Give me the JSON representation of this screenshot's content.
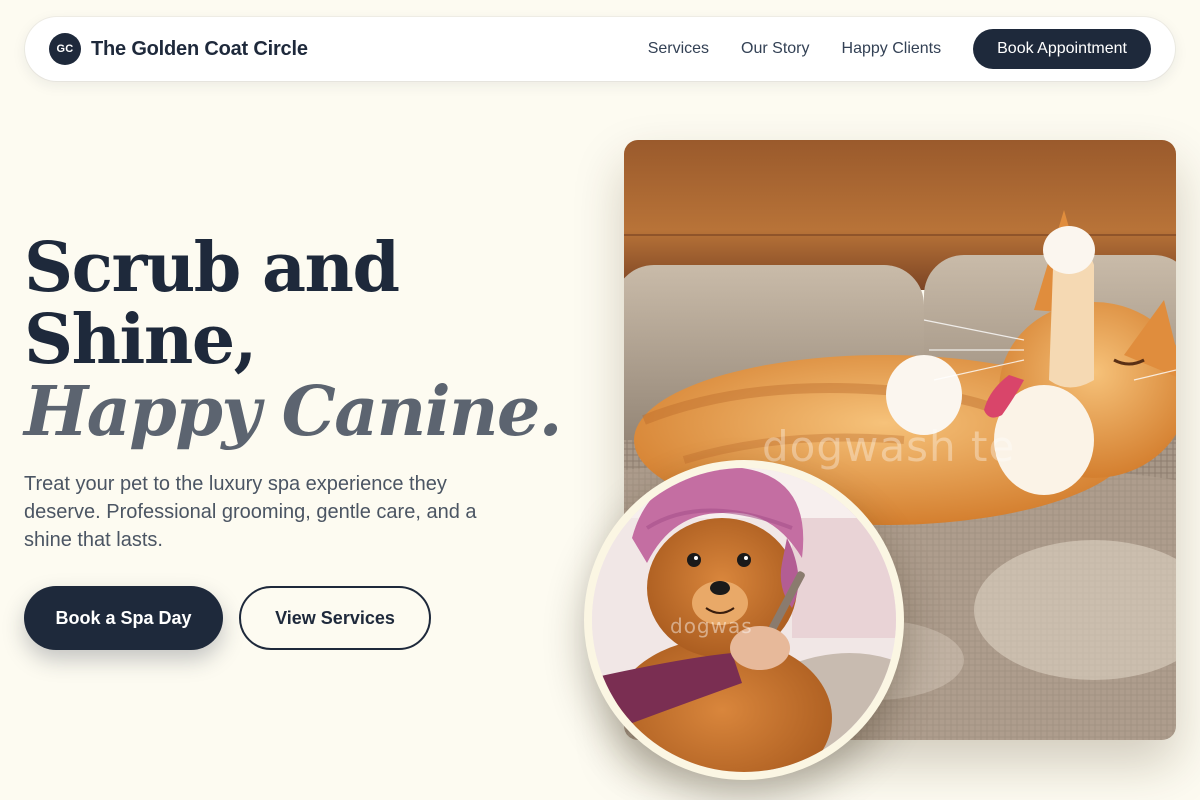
{
  "brand": {
    "logo_initials": "GC",
    "name": "The Golden Coat Circle"
  },
  "nav": {
    "links": [
      "Services",
      "Our Story",
      "Happy Clients"
    ],
    "cta_label": "Book Appointment"
  },
  "hero": {
    "title_line1": "Scrub and",
    "title_line2": "Shine,",
    "title_accent": "Happy Canine.",
    "subtitle": "Treat your pet to the luxury spa experience they deserve. Professional grooming, gentle care, and a shine that lasts.",
    "primary_cta": "Book a Spa Day",
    "secondary_cta": "View Services"
  },
  "images": {
    "main_watermark": "dogwash  te",
    "round_watermark": "dogwas"
  },
  "colors": {
    "background": "#fdfbf1",
    "navy": "#1e293b",
    "accent_gray": "#5c6470",
    "round_frame": "#fbf6e3"
  },
  "icons": {
    "main_photo": "orange-cat-on-sofa-photo",
    "round_photo": "dog-in-pink-towel-photo"
  }
}
